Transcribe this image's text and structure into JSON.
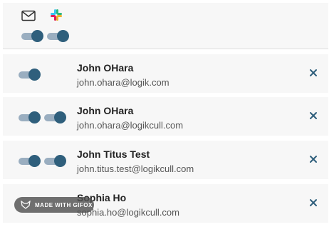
{
  "header": {
    "email_icon": "envelope-icon",
    "slack_icon": "slack-icon",
    "email_toggle_on": true,
    "slack_toggle_on": true
  },
  "recipients": [
    {
      "name": "John OHara",
      "email": "john.ohara@logik.com",
      "email_toggle_on": true,
      "slack_toggle_on": null
    },
    {
      "name": "John OHara",
      "email": "john.ohara@logikcull.com",
      "email_toggle_on": true,
      "slack_toggle_on": true
    },
    {
      "name": "John Titus Test",
      "email": "john.titus.test@logikcull.com",
      "email_toggle_on": true,
      "slack_toggle_on": true
    },
    {
      "name": "Sophia Ho",
      "email": "sophia.ho@logikcull.com",
      "email_toggle_on": null,
      "slack_toggle_on": null
    }
  ],
  "watermark": {
    "text": "MADE WITH GIFOX"
  },
  "colors": {
    "accent": "#2f5f7c",
    "track": "#9aaec0",
    "row_bg": "#f7f7f7"
  }
}
